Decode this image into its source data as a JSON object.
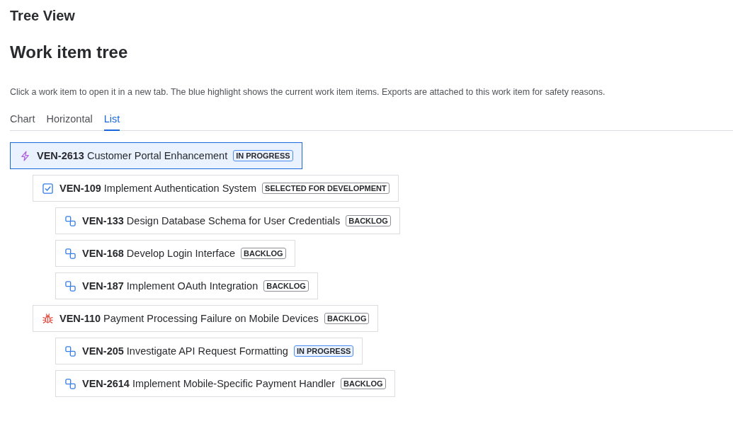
{
  "page": {
    "title": "Tree View",
    "heading": "Work item tree",
    "description": "Click a work item to open it in a new tab. The blue highlight shows the current work item items. Exports are attached to this work item for safety reasons."
  },
  "tabs": [
    {
      "label": "Chart",
      "selected": false
    },
    {
      "label": "Horizontal",
      "selected": false
    },
    {
      "label": "List",
      "selected": true
    }
  ],
  "tree": [
    {
      "kind": "epic",
      "key": "VEN-2613",
      "title": "Customer Portal Enhancement",
      "status": {
        "text": "IN PROGRESS",
        "kind": "in-progress"
      },
      "selected": true,
      "children": [
        {
          "kind": "story",
          "key": "VEN-109",
          "title": "Implement Authentication System",
          "status": {
            "text": "SELECTED FOR DEVELOPMENT",
            "kind": "todo"
          },
          "selected": false,
          "children": [
            {
              "kind": "subtask",
              "key": "VEN-133",
              "title": "Design Database Schema for User Credentials",
              "status": {
                "text": "BACKLOG",
                "kind": "todo"
              },
              "selected": false
            },
            {
              "kind": "subtask",
              "key": "VEN-168",
              "title": "Develop Login Interface",
              "status": {
                "text": "BACKLOG",
                "kind": "todo"
              },
              "selected": false
            },
            {
              "kind": "subtask",
              "key": "VEN-187",
              "title": "Implement OAuth Integration",
              "status": {
                "text": "BACKLOG",
                "kind": "todo"
              },
              "selected": false
            }
          ]
        },
        {
          "kind": "bug",
          "key": "VEN-110",
          "title": "Payment Processing Failure on Mobile Devices",
          "status": {
            "text": "BACKLOG",
            "kind": "todo"
          },
          "selected": false,
          "children": [
            {
              "kind": "subtask",
              "key": "VEN-205",
              "title": "Investigate API Request Formatting",
              "status": {
                "text": "IN PROGRESS",
                "kind": "in-progress"
              },
              "selected": false
            },
            {
              "kind": "subtask",
              "key": "VEN-2614",
              "title": "Implement Mobile-Specific Payment Handler",
              "status": {
                "text": "BACKLOG",
                "kind": "todo"
              },
              "selected": false
            }
          ]
        }
      ]
    }
  ]
}
